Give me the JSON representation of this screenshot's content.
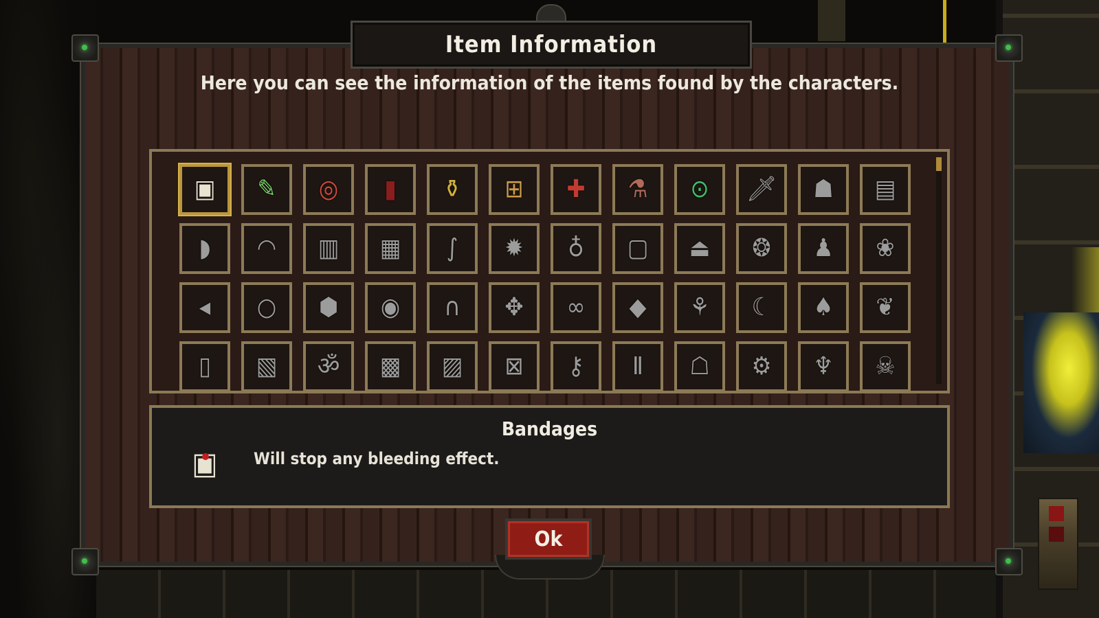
{
  "dialog": {
    "title": "Item Information",
    "subtitle": "Here you can see the information of the items found by the characters."
  },
  "items": [
    {
      "icon": "bandages-icon",
      "glyph": "▣",
      "selected": true
    },
    {
      "icon": "syringe-knife-icon",
      "glyph": "✎"
    },
    {
      "icon": "target-icon",
      "glyph": "◎"
    },
    {
      "icon": "red-stick-icon",
      "glyph": "▮"
    },
    {
      "icon": "spray-bottle-icon",
      "glyph": "⚱"
    },
    {
      "icon": "medkit-bag-icon",
      "glyph": "⊞"
    },
    {
      "icon": "first-aid-kit-icon",
      "glyph": "✚"
    },
    {
      "icon": "bottle-pack-icon",
      "glyph": "⚗"
    },
    {
      "icon": "green-gadget-icon",
      "glyph": "⊙"
    },
    {
      "icon": "dagger-icon",
      "glyph": "🗡"
    },
    {
      "icon": "bust-icon",
      "glyph": "☗"
    },
    {
      "icon": "fabric-icon",
      "glyph": "▤"
    },
    {
      "icon": "helmet-icon",
      "glyph": "◗"
    },
    {
      "icon": "cap-icon",
      "glyph": "◠"
    },
    {
      "icon": "jacket-icon",
      "glyph": "▥"
    },
    {
      "icon": "vest-icon",
      "glyph": "▦"
    },
    {
      "icon": "feather-icon",
      "glyph": "∫"
    },
    {
      "icon": "sun-badge-icon",
      "glyph": "✹"
    },
    {
      "icon": "amulet-icon",
      "glyph": "♁"
    },
    {
      "icon": "picture-frame-icon",
      "glyph": "▢"
    },
    {
      "icon": "dress-icon",
      "glyph": "⏏"
    },
    {
      "icon": "shell-icon",
      "glyph": "❂"
    },
    {
      "icon": "sack-icon",
      "glyph": "♟"
    },
    {
      "icon": "blossom-icon",
      "glyph": "❀"
    },
    {
      "icon": "fish-icon",
      "glyph": "◂"
    },
    {
      "icon": "ring-icon",
      "glyph": "○"
    },
    {
      "icon": "rock-icon",
      "glyph": "⬢"
    },
    {
      "icon": "eye-orb-icon",
      "glyph": "◉"
    },
    {
      "icon": "pants-icon",
      "glyph": "∩"
    },
    {
      "icon": "puzzle-icon",
      "glyph": "✥"
    },
    {
      "icon": "goggles-icon",
      "glyph": "∞"
    },
    {
      "icon": "crystals-icon",
      "glyph": "◆"
    },
    {
      "icon": "coral-icon",
      "glyph": "⚘"
    },
    {
      "icon": "fang-icon",
      "glyph": "☾"
    },
    {
      "icon": "lamp-icon",
      "glyph": "♠"
    },
    {
      "icon": "pumpkin-icon",
      "glyph": "❦"
    },
    {
      "icon": "vial-icon",
      "glyph": "▯"
    },
    {
      "icon": "box-icon",
      "glyph": "▧"
    },
    {
      "icon": "om-symbol-icon",
      "glyph": "ॐ"
    },
    {
      "icon": "speaker-icon",
      "glyph": "▩"
    },
    {
      "icon": "camera-icon",
      "glyph": "▨"
    },
    {
      "icon": "machine-icon",
      "glyph": "⊠"
    },
    {
      "icon": "key-tool-icon",
      "glyph": "⚷"
    },
    {
      "icon": "trousers-icon",
      "glyph": "Ⅱ"
    },
    {
      "icon": "coat-icon",
      "glyph": "☖"
    },
    {
      "icon": "gear-ring-icon",
      "glyph": "⚙"
    },
    {
      "icon": "pendant-icon",
      "glyph": "♆"
    },
    {
      "icon": "skull-bones-icon",
      "glyph": "☠"
    }
  ],
  "selected_item": {
    "name": "Bandages",
    "description": "Will stop any bleeding effect."
  },
  "buttons": {
    "ok_label": "Ok"
  }
}
